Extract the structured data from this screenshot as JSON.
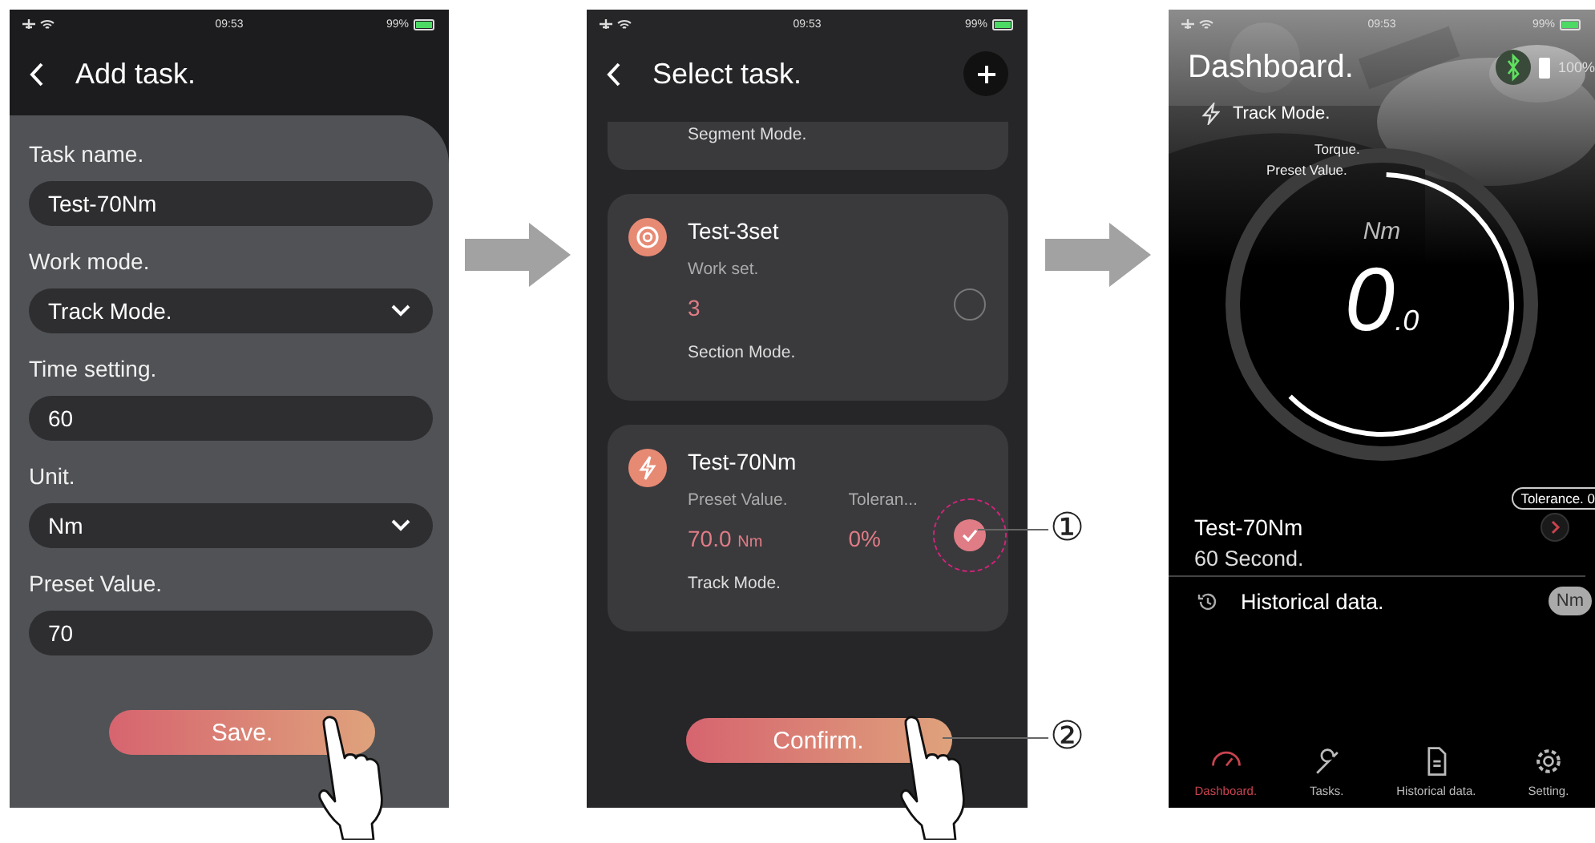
{
  "screens": [
    {
      "kind": "add_task",
      "status": {
        "time": "09:53",
        "battery": "99%"
      },
      "title": "Add task.",
      "fields": [
        {
          "kind": "text",
          "label": "Task name.",
          "value": "Test-70Nm"
        },
        {
          "kind": "dropdown",
          "label": "Work mode.",
          "value": "Track Mode."
        },
        {
          "kind": "text",
          "label": "Time setting.",
          "value": "60"
        },
        {
          "kind": "dropdown",
          "label": "Unit.",
          "value": "Nm"
        },
        {
          "kind": "text",
          "label": "Preset Value.",
          "value": "70"
        }
      ],
      "button": "Save."
    },
    {
      "kind": "select_task",
      "status": {
        "time": "09:53",
        "battery": "99%"
      },
      "title": "Select task.",
      "partial_mode": "Segment Mode.",
      "tasks": [
        {
          "kind": "set",
          "name": "Test-3set",
          "selected": false,
          "fields": [
            {
              "label": "Work set.",
              "value": "3"
            }
          ],
          "mode": "Section Mode."
        },
        {
          "kind": "track",
          "name": "Test-70Nm",
          "selected": true,
          "fields": [
            {
              "label": "Preset Value.",
              "value": "70.0",
              "unit": "Nm"
            },
            {
              "label": "Toleran...",
              "value": "0%"
            }
          ],
          "mode": "Track Mode."
        }
      ],
      "button": "Confirm."
    },
    {
      "kind": "dashboard",
      "status": {
        "time": "09:53",
        "battery": "99%"
      },
      "title": "Dashboard.",
      "device_battery": "100%",
      "mode": "Track Mode.",
      "gauge": {
        "top_label": "Torque.",
        "preset_label": "Preset Value.",
        "unit": "Nm",
        "value": "0",
        "decimal": ".0",
        "level": 0.62
      },
      "tolerance": "Tolerance. 0",
      "task_name": "Test-70Nm",
      "duration": "60 Second.",
      "history_label": "Historical data.",
      "unit_badge": "Nm",
      "tabs": [
        {
          "kind": "dashboard",
          "label": "Dashboard.",
          "selected": true
        },
        {
          "kind": "tasks",
          "label": "Tasks.",
          "selected": false
        },
        {
          "kind": "history",
          "label": "Historical data.",
          "selected": false
        },
        {
          "kind": "setting",
          "label": "Setting.",
          "selected": false
        }
      ]
    }
  ],
  "callouts": [
    "①",
    "②"
  ]
}
